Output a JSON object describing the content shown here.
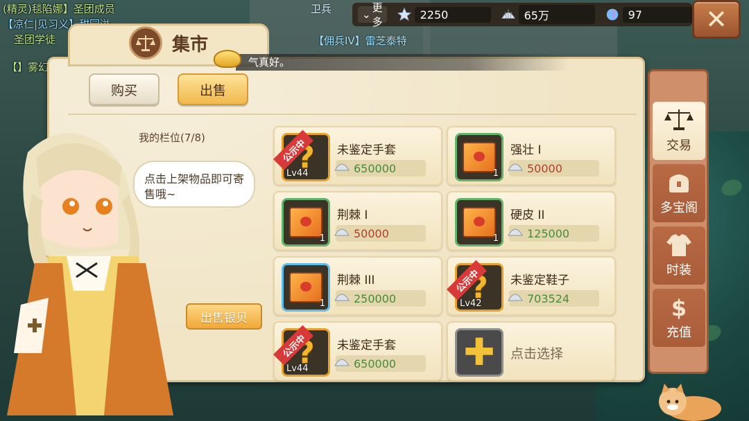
{
  "background": {
    "chat_lines": [
      "(精灵)毯陷娜】圣团成员",
      "【凉仁|见习义】甜园溢",
      "圣团学徒",
      "【】雾幻"
    ],
    "npc_labels": [
      "卫兵",
      "【佣兵IV】雷芝泰特"
    ]
  },
  "resources": {
    "more_label": "更多",
    "stars": "2250",
    "shells": "65万",
    "gems": "97"
  },
  "panel": {
    "title": "集市",
    "notice": "气真好。",
    "tabs": {
      "buy": "购买",
      "sell": "出售"
    },
    "slot_label": "我的栏位(7/8)",
    "speech": "点击上架物品即可寄售哦~",
    "sell_silver": "出售银贝"
  },
  "items": [
    {
      "name": "未鉴定手套",
      "price": "650000",
      "price_color": "green",
      "level": "Lv44",
      "ribbon": "公示中",
      "kind": "unknown"
    },
    {
      "name": "强壮 I",
      "price": "50000",
      "price_color": "red",
      "qty": "1",
      "kind": "book"
    },
    {
      "name": "荆棘 I",
      "price": "50000",
      "price_color": "red",
      "qty": "1",
      "kind": "book"
    },
    {
      "name": "硬皮 II",
      "price": "125000",
      "price_color": "green",
      "qty": "1",
      "kind": "book"
    },
    {
      "name": "荆棘 III",
      "price": "250000",
      "price_color": "green",
      "qty": "1",
      "kind": "book-blue"
    },
    {
      "name": "未鉴定鞋子",
      "price": "703524",
      "price_color": "green",
      "level": "Lv42",
      "ribbon": "公示中",
      "kind": "unknown"
    },
    {
      "name": "未鉴定手套",
      "price": "650000",
      "price_color": "green",
      "level": "Lv44",
      "ribbon": "公示中",
      "kind": "unknown"
    }
  ],
  "add_slot": {
    "label": "点击选择"
  },
  "sidenav": {
    "trade": "交易",
    "treasure": "多宝阁",
    "fashion": "时装",
    "recharge": "充值"
  },
  "colors": {
    "panel_bg": "#f1e5c6",
    "sell_tab": "#f0b94c",
    "ribbon": "#d73a38",
    "sidenav": "#cf8f6a"
  }
}
